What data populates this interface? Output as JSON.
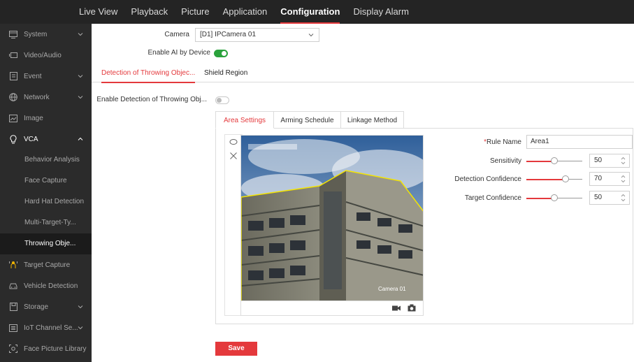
{
  "topnav": {
    "items": [
      "Live View",
      "Playback",
      "Picture",
      "Application",
      "Configuration",
      "Display Alarm"
    ],
    "active": "Configuration"
  },
  "sidebar": {
    "items": [
      {
        "label": "System",
        "icon": "monitor-icon",
        "chevron": "down"
      },
      {
        "label": "Video/Audio",
        "icon": "video-icon"
      },
      {
        "label": "Event",
        "icon": "event-icon",
        "chevron": "down"
      },
      {
        "label": "Network",
        "icon": "globe-icon",
        "chevron": "down"
      },
      {
        "label": "Image",
        "icon": "image-icon"
      },
      {
        "label": "VCA",
        "icon": "lightbulb-icon",
        "chevron": "up"
      }
    ],
    "vca_sub": [
      "Behavior Analysis",
      "Face Capture",
      "Hard Hat Detection",
      "Multi-Target-Ty...",
      "Throwing Obje..."
    ],
    "vca_active": "Throwing Obje...",
    "items_after": [
      {
        "label": "Target Capture",
        "icon": "person-icon"
      },
      {
        "label": "Vehicle Detection",
        "icon": "car-icon"
      },
      {
        "label": "Storage",
        "icon": "storage-icon",
        "chevron": "down"
      },
      {
        "label": "IoT Channel Se...",
        "icon": "iot-icon",
        "chevron": "down"
      },
      {
        "label": "Face Picture Library",
        "icon": "face-scan-icon"
      }
    ]
  },
  "camera": {
    "label": "Camera",
    "value": "[D1] IPCamera 01"
  },
  "enable_ai": {
    "label": "Enable AI by Device",
    "on": true
  },
  "tabs": [
    "Detection of Throwing Objec...",
    "Shield Region"
  ],
  "enable_detection": {
    "label": "Enable Detection of Throwing Obj...",
    "on": false
  },
  "subtabs": [
    "Area Settings",
    "Arming Schedule",
    "Linkage Method"
  ],
  "video": {
    "overlay_title": "",
    "overlay_label": "Camera 01"
  },
  "settings": {
    "rule_name": {
      "label": "Rule Name",
      "required_mark": "*",
      "value": "Area1"
    },
    "sensitivity": {
      "label": "Sensitivity",
      "value": "50",
      "level": 0.5
    },
    "detection_confidence": {
      "label": "Detection Confidence",
      "value": "70",
      "level": 0.7
    },
    "target_confidence": {
      "label": "Target Confidence",
      "value": "50",
      "level": 0.5
    }
  },
  "save_label": "Save",
  "colors": {
    "accent": "#e4393c",
    "toggle_on": "#2aa23c",
    "nav_bg": "#242424",
    "sidebar_bg": "#2b2b2b"
  }
}
